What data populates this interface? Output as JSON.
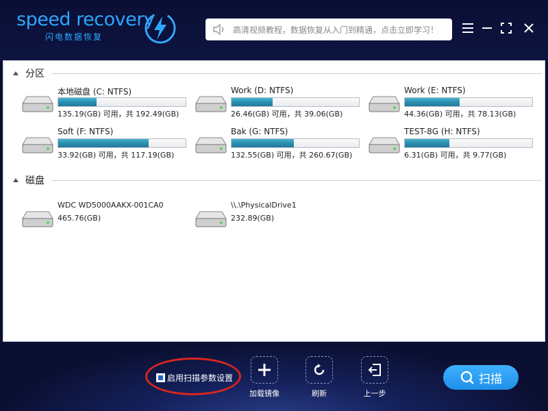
{
  "app": {
    "logo_text": "speed recovery",
    "logo_sub": "闪电数据恢复",
    "search_placeholder": "高清视频教程，数据恢复从入门到精通，点击立即学习！"
  },
  "sections": {
    "partitions_label": "分区",
    "disks_label": "磁盘"
  },
  "partitions": [
    {
      "name": "本地磁盘 (C: NTFS)",
      "space": "135.19(GB) 可用，共 192.49(GB)",
      "used_fraction": 0.3
    },
    {
      "name": "Work (D: NTFS)",
      "space": "26.46(GB) 可用，共 39.06(GB)",
      "used_fraction": 0.32
    },
    {
      "name": "Work (E: NTFS)",
      "space": "44.36(GB) 可用，共 78.13(GB)",
      "used_fraction": 0.43
    },
    {
      "name": "Soft (F: NTFS)",
      "space": "33.92(GB) 可用，共 117.19(GB)",
      "used_fraction": 0.71
    },
    {
      "name": "Bak (G: NTFS)",
      "space": "132.55(GB) 可用，共 260.67(GB)",
      "used_fraction": 0.49
    },
    {
      "name": "TEST-8G (H: NTFS)",
      "space": "6.31(GB) 可用，共 9.77(GB)",
      "used_fraction": 0.35
    }
  ],
  "disks": [
    {
      "name": "WDC WD5000AAKX-001CA0",
      "size": "465.76(GB)"
    },
    {
      "name": "\\\\.\\PhysicalDrive1",
      "size": "232.89(GB)"
    }
  ],
  "footer": {
    "scan_params_label": "启用扫描参数设置",
    "add_image_label": "加载镜像",
    "refresh_label": "刷新",
    "back_label": "上一步",
    "scan_label": "扫描"
  },
  "colors": {
    "brand": "#2ea6ff",
    "bar_fill": "#2b8fb0",
    "scan_button": "#1e8fe8",
    "annotation": "#d9251d"
  }
}
